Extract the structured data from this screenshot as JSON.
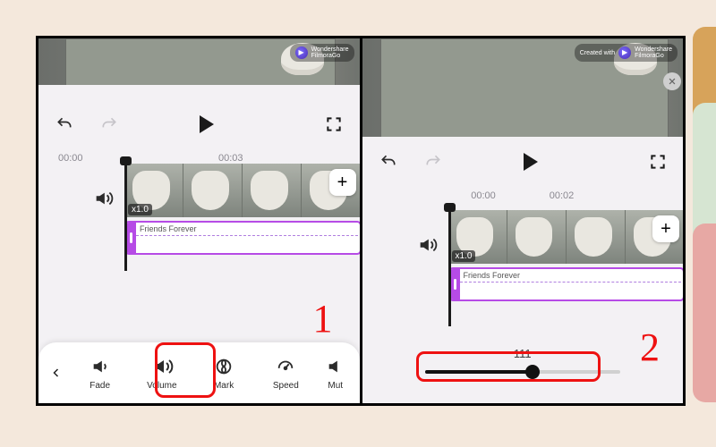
{
  "watermark": {
    "brand_line1": "Wondershare",
    "brand_line2": "FilmoraGo",
    "created": "Created with"
  },
  "panel1": {
    "time_start": "00:00",
    "time_end": "00:03",
    "clip_rate": "x1.0",
    "audio_title": "Friends Forever",
    "annot": "1",
    "toolbar": [
      {
        "icon": "fade",
        "label": "Fade"
      },
      {
        "icon": "volume",
        "label": "Volume"
      },
      {
        "icon": "mark",
        "label": "Mark"
      },
      {
        "icon": "speed",
        "label": "Speed"
      },
      {
        "icon": "mute",
        "label": "Mut"
      }
    ]
  },
  "panel2": {
    "time_start": "00:00",
    "time_end": "00:02",
    "clip_rate": "x1.0",
    "audio_title": "Friends Forever",
    "annot": "2",
    "volume_value": "111",
    "volume_percent": 55
  }
}
